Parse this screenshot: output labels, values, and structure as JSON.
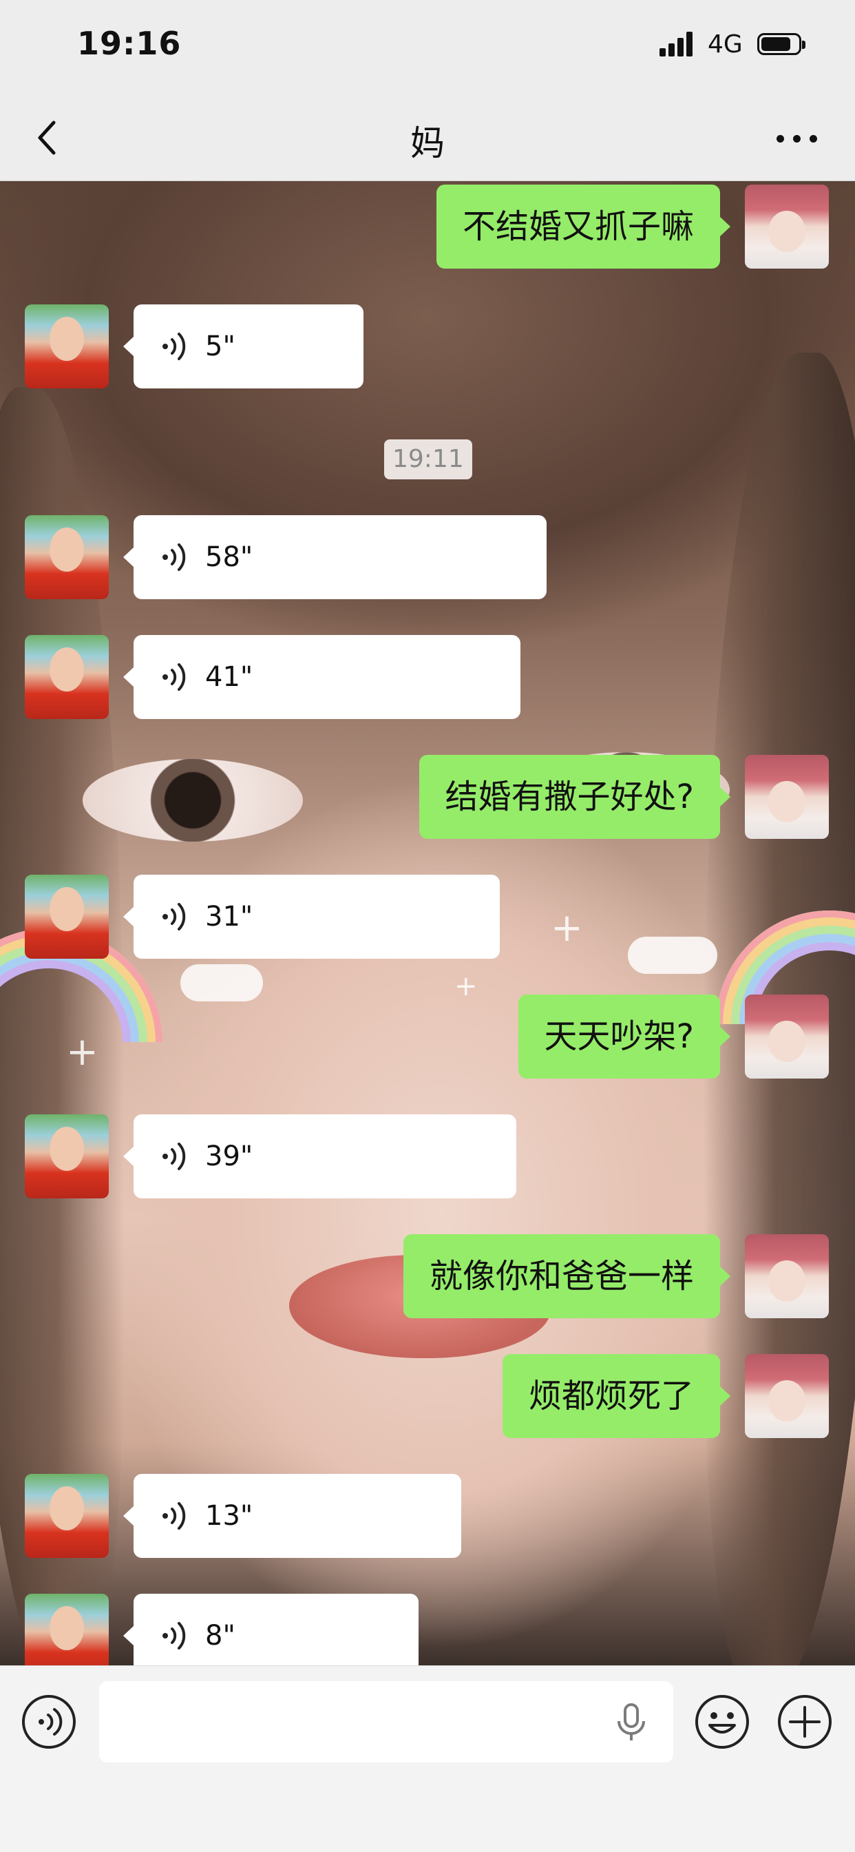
{
  "status_bar": {
    "time": "19:16",
    "network": "4G",
    "battery_level": 0.8
  },
  "nav": {
    "title": "妈",
    "back_icon": "chevron-left-icon",
    "more_icon": "ellipsis-icon"
  },
  "messages": [
    {
      "side": "out",
      "type": "text",
      "text": "不结婚又抓子嘛"
    },
    {
      "side": "in",
      "type": "voice",
      "duration": "5\""
    },
    {
      "type": "timestamp",
      "text": "19:11"
    },
    {
      "side": "in",
      "type": "voice",
      "duration": "58\""
    },
    {
      "side": "in",
      "type": "voice",
      "duration": "41\""
    },
    {
      "side": "out",
      "type": "text",
      "text": "结婚有撒子好处?"
    },
    {
      "side": "in",
      "type": "voice",
      "duration": "31\""
    },
    {
      "side": "out",
      "type": "text",
      "text": "天天吵架?"
    },
    {
      "side": "in",
      "type": "voice",
      "duration": "39\""
    },
    {
      "side": "out",
      "type": "text",
      "text": "就像你和爸爸一样"
    },
    {
      "side": "out",
      "type": "text",
      "text": "烦都烦死了"
    },
    {
      "side": "in",
      "type": "voice",
      "duration": "13\""
    },
    {
      "side": "in",
      "type": "voice",
      "duration": "8\""
    }
  ],
  "input_bar": {
    "voice_toggle_icon": "voice-mode-icon",
    "mic_icon": "microphone-icon",
    "emoji_icon": "emoji-icon",
    "add_icon": "plus-icon"
  }
}
